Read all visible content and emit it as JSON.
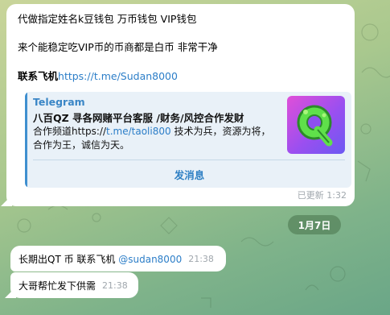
{
  "messages": {
    "forwarded": {
      "line1": "代做指定姓名k豆钱包 万币钱包 VIP钱包",
      "line2": "来个能稳定吃VIP币的币商都是白币 非常干净",
      "contact_label": "联系飞机",
      "contact_link": "https://t.me/Sudan8000",
      "preview": {
        "site": "Telegram",
        "title": "八百QZ 寻各网赌平台客服 /财务/风控合作发财",
        "desc_prefix": "合作频道https://",
        "desc_link": "t.me/taoli800",
        "desc_suffix": " 技术为兵，资源为将，合作为王，诚信为天。",
        "button": "发消息",
        "thumb_icon": "green-q-logo-icon"
      },
      "meta": "已更新 1:32"
    },
    "date_separator": "1月7日",
    "msg1": {
      "text": "长期出QT 币  联系飞机 ",
      "mention": "@sudan8000",
      "time": "21:38"
    },
    "msg2": {
      "text": "大哥帮忙发下供需",
      "time": "21:38"
    }
  },
  "colors": {
    "link": "#2c7ec8",
    "date_pill": "#548058",
    "background_top": "#c9d59a",
    "background_bottom": "#6aa687"
  }
}
